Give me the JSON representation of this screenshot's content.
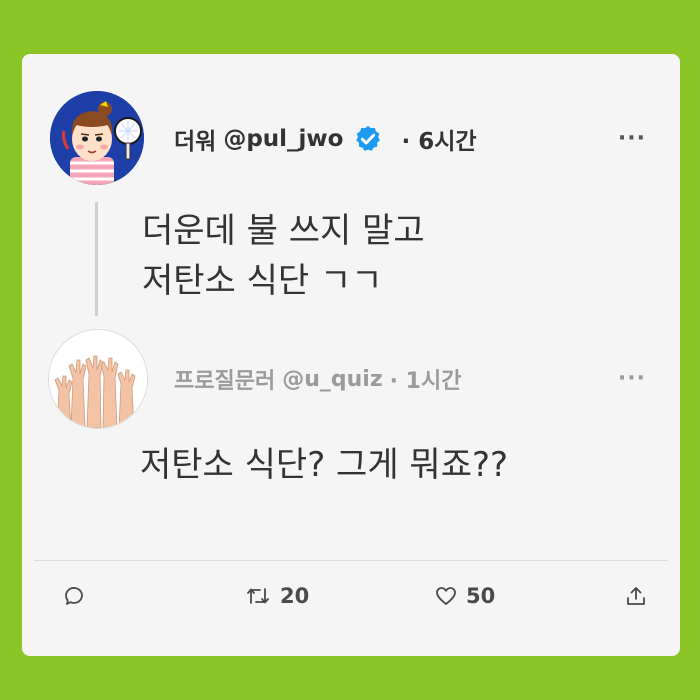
{
  "original_tweet": {
    "display_name": "더워",
    "handle": "@pul_jwo",
    "time": "· 6시간",
    "more": "···",
    "lines": [
      "더운데 불 쓰지 말고",
      "저탄소 식단 ㄱㄱ"
    ]
  },
  "reply_tweet": {
    "display_name": "프로질문러",
    "handle": "@u_quiz",
    "time": "· 1시간",
    "more": "···",
    "text": "저탄소 식단? 그게 뭐죠??"
  },
  "actions": {
    "retweet_count": "20",
    "like_count": "50"
  },
  "colors": {
    "background": "#8cc527",
    "card": "#f5f5f5",
    "verified": "#1d9bf0"
  },
  "icons": [
    "verified-badge-icon",
    "more-icon",
    "reply-icon",
    "retweet-icon",
    "like-icon",
    "share-icon"
  ]
}
